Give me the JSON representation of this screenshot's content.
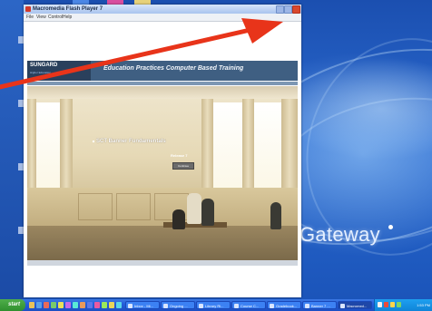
{
  "window": {
    "title": "Macromedia Flash Player 7",
    "menu": [
      "File",
      "View",
      "Control",
      "Help"
    ]
  },
  "flash": {
    "logo_text": "SUNGARD",
    "logo_subtitle": "Higher Education",
    "banner_title": "Education Practices Computer Based Training",
    "course_title": "SCT Banner Fundamentals",
    "release": "Release 7",
    "continue_label": "Continue"
  },
  "desktop": {
    "brand": "Gateway"
  },
  "taskbar": {
    "start_label": "start",
    "tasks": [
      "Inbox - Mi...",
      "Ongoing ...",
      "Library Ri...",
      "Course C...",
      "Gradebook...",
      "Banner 7 ...",
      "Macromed..."
    ],
    "clock": "1:53 PM"
  },
  "annotation": {
    "arrow_color": "#e8341a",
    "points_to": "close-button"
  },
  "colors": {
    "banner": "#3f5f82",
    "desktop": "#1f57b6"
  }
}
